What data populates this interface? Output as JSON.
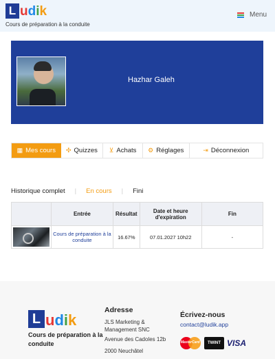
{
  "header": {
    "logo_letters": [
      "L",
      "u",
      "d",
      "i",
      "k"
    ],
    "logo_colors": [
      "#ffffff",
      "#e53935",
      "#1e88e5",
      "#43a047",
      "#f39c12"
    ],
    "subtitle": "Cours de préparation à la conduite",
    "menu_label": "Menu",
    "menu_icon": "hamburger-icon"
  },
  "profile": {
    "name": "Hazhar Galeh",
    "background_color": "#1f3f9a"
  },
  "tabs": [
    {
      "label": "Mes cours",
      "icon": "courses-icon",
      "active": true
    },
    {
      "label": "Quizzes",
      "icon": "puzzle-icon",
      "active": false
    },
    {
      "label": "Achats",
      "icon": "cart-icon",
      "active": false
    },
    {
      "label": "Réglages",
      "icon": "settings-icon",
      "active": false
    },
    {
      "label": "Déconnexion",
      "icon": "logout-icon",
      "active": false
    }
  ],
  "filters": {
    "all": "Historique complet",
    "in_progress": "En cours",
    "finished": "Fini"
  },
  "table": {
    "headers": [
      "",
      "Entrée",
      "Résultat",
      "Date et heure d'expiration",
      "Fin"
    ],
    "rows": [
      {
        "course": "Cours de préparation à la conduite",
        "result": "16.67%",
        "expiration": "07.01.2027 10h22",
        "end": "-"
      }
    ]
  },
  "footer": {
    "tagline": "Cours de préparation à la conduite",
    "address_title": "Adresse",
    "address_company": "JLS Marketing & Management SNC",
    "address_street": "Avenue des Cadoles 12b",
    "address_city": "2000 Neuchâtel",
    "contact_title": "Écrivez-nous",
    "contact_email": "contact@ludik.app",
    "payment_mastercard": "MasterCard",
    "payment_twint": "TWINT",
    "payment_visa": "VISA"
  },
  "colors": {
    "accent": "#f39c12",
    "brand": "#1f3f9a"
  }
}
